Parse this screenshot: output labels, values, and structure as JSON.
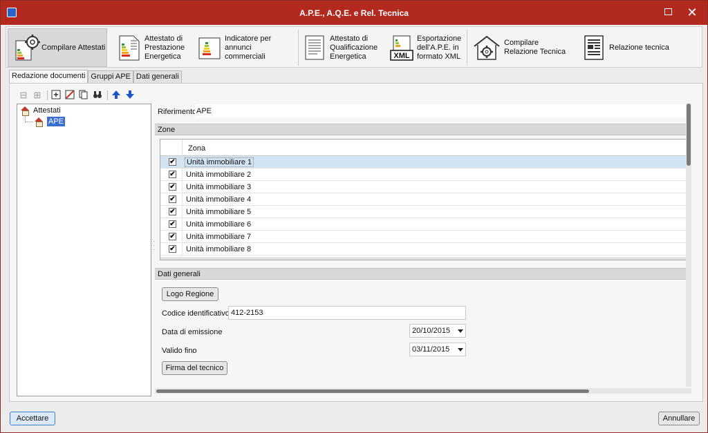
{
  "window": {
    "title": "A.P.E., A.Q.E. e Rel. Tecnica",
    "maximize": "",
    "close": "✕"
  },
  "toolbar": {
    "buttons": [
      {
        "label": "Compilare Attestati",
        "icon": "gear-document-icon"
      },
      {
        "label": "Attestato di Prestazione Energetica",
        "icon": "energy-certificate-icon"
      },
      {
        "label": "Indicatore per annunci commerciali",
        "icon": "energy-indicator-icon"
      },
      {
        "label": "Attestato di Qualificazione Energetica",
        "icon": "document-icon"
      },
      {
        "label": "Esportazione dell'A.P.E. in formato XML",
        "icon": "xml-icon"
      },
      {
        "label": "Compilare Relazione Tecnica",
        "icon": "house-gear-icon"
      },
      {
        "label": "Relazione tecnica",
        "icon": "report-icon"
      }
    ],
    "xml_text": "XML"
  },
  "tabs": [
    "Redazione documenti",
    "Gruppi APE",
    "Dati generali"
  ],
  "tree": {
    "root": "Attestati",
    "child": "APE"
  },
  "form": {
    "riferimento_label": "Riferimento",
    "riferimento_value": "APE",
    "zone_group": "Zone",
    "zona_header": "Zona",
    "zone_rows": [
      "Unità immobiliare 1",
      "Unità immobiliare 2",
      "Unità immobiliare 3",
      "Unità immobiliare 4",
      "Unità immobiliare 5",
      "Unità immobiliare 6",
      "Unità immobiliare 7",
      "Unità immobiliare 8"
    ],
    "check_mark": "✔",
    "dati_generali_group": "Dati generali",
    "logo_regione": "Logo Regione",
    "codice_label": "Codice identificativo",
    "codice_value": "412-2153",
    "data_emissione_label": "Data di emissione",
    "data_emissione_value": "20/10/2015",
    "valido_fino_label": "Valido fino",
    "valido_fino_value": "03/11/2015",
    "firma_tecnico": "Firma del tecnico"
  },
  "footer": {
    "accept": "Accettare",
    "cancel": "Annullare"
  }
}
